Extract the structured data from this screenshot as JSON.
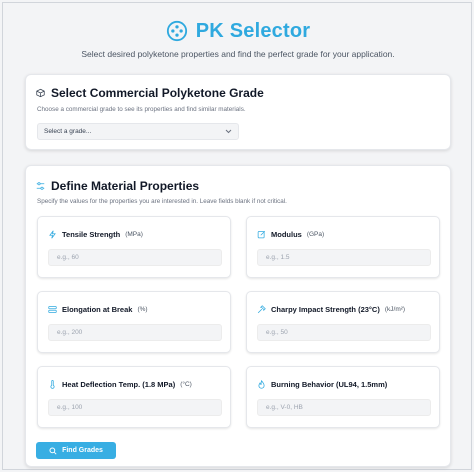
{
  "header": {
    "title": "PK Selector",
    "subtitle": "Select desired polyketone properties and find the perfect grade for your application.",
    "logo_icon": "molecule-icon",
    "brand_color": "#2fa9df"
  },
  "grade_section": {
    "title": "Select Commercial Polyketone Grade",
    "description": "Choose a commercial grade to see its properties and find similar materials.",
    "icon": "cube-icon",
    "select_value": "Select a grade..."
  },
  "properties_section": {
    "title": "Define Material Properties",
    "description": "Specify the values for the properties you are interested in. Leave fields blank if not critical.",
    "icon": "sliders-icon",
    "fields": [
      {
        "label": "Tensile Strength",
        "unit": "(MPa)",
        "placeholder": "e.g., 60",
        "icon": "bolt-icon"
      },
      {
        "label": "Modulus",
        "unit": "(GPa)",
        "placeholder": "e.g., 1.5",
        "icon": "edit-icon"
      },
      {
        "label": "Elongation at Break",
        "unit": "(%)",
        "placeholder": "e.g., 200",
        "icon": "stretch-icon"
      },
      {
        "label": "Charpy Impact Strength (23°C)",
        "unit": "(kJ/m²)",
        "placeholder": "e.g., 50",
        "icon": "hammer-icon"
      },
      {
        "label": "Heat Deflection Temp. (1.8 MPa)",
        "unit": "(°C)",
        "placeholder": "e.g., 100",
        "icon": "thermometer-icon"
      },
      {
        "label": "Burning Behavior (UL94, 1.5mm)",
        "unit": "",
        "placeholder": "e.g., V-0, HB",
        "icon": "flame-icon"
      }
    ],
    "button_label": "Find Grades",
    "button_icon": "search-icon",
    "accent_color": "#38aee3"
  }
}
